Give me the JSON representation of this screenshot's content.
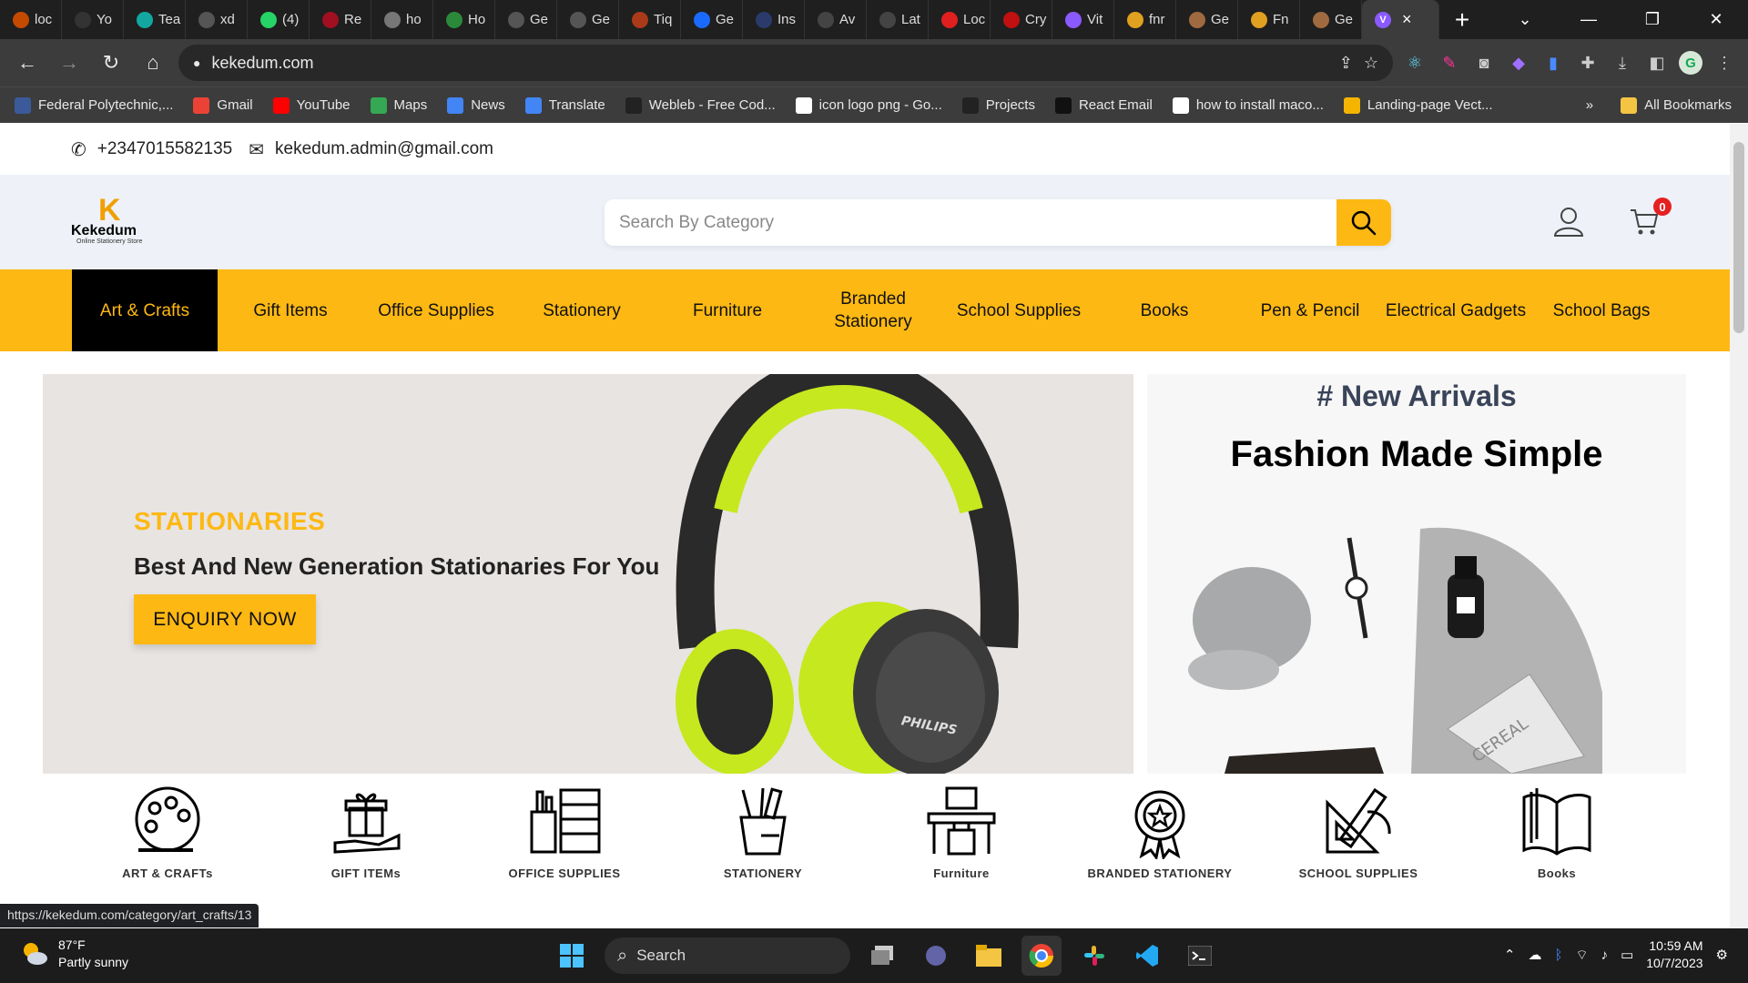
{
  "browser": {
    "tabs": [
      {
        "label": "loc",
        "color": "#c44a00"
      },
      {
        "label": "Yo",
        "color": "#333"
      },
      {
        "label": "Tea",
        "color": "#12a8a0"
      },
      {
        "label": "xd",
        "color": "#555"
      },
      {
        "label": "(4)",
        "color": "#25d366"
      },
      {
        "label": "Re",
        "color": "#a01020"
      },
      {
        "label": "ho",
        "color": "#777"
      },
      {
        "label": "Ho",
        "color": "#2a8a3a"
      },
      {
        "label": "Ge",
        "color": "#555"
      },
      {
        "label": "Ge",
        "color": "#555"
      },
      {
        "label": "Tiq",
        "color": "#aa3a1a"
      },
      {
        "label": "Ge",
        "color": "#1a6aff"
      },
      {
        "label": "Ins",
        "color": "#2a3a6a"
      },
      {
        "label": "Av",
        "color": "#444"
      },
      {
        "label": "Lat",
        "color": "#444"
      },
      {
        "label": "Loc",
        "color": "#e02020"
      },
      {
        "label": "Cry",
        "color": "#c01010"
      },
      {
        "label": "Vit",
        "color": "#8a5aff"
      },
      {
        "label": "fnr",
        "color": "#e0a020"
      },
      {
        "label": "Ge",
        "color": "#a06a40"
      },
      {
        "label": "Fn",
        "color": "#e0a020"
      },
      {
        "label": "Ge",
        "color": "#a06a40"
      }
    ],
    "active_tab_close": "×",
    "new_tab": "+",
    "url": "kekedum.com",
    "bookmarks": [
      {
        "label": "Federal Polytechnic,...",
        "color": "#3a5a9a"
      },
      {
        "label": "Gmail",
        "color": "#ea4335"
      },
      {
        "label": "YouTube",
        "color": "#ff0000"
      },
      {
        "label": "Maps",
        "color": "#34a853"
      },
      {
        "label": "News",
        "color": "#4285f4"
      },
      {
        "label": "Translate",
        "color": "#4285f4"
      },
      {
        "label": "Webleb - Free Cod...",
        "color": "#222"
      },
      {
        "label": "icon logo png - Go...",
        "color": "#fff"
      },
      {
        "label": "Projects",
        "color": "#222"
      },
      {
        "label": "React Email",
        "color": "#111"
      },
      {
        "label": "how to install maco...",
        "color": "#fff"
      },
      {
        "label": "Landing-page Vect...",
        "color": "#f4b400"
      }
    ],
    "bookmarks_overflow": "»",
    "all_bookmarks": "All Bookmarks",
    "profile_letter": "G",
    "status_url": "https://kekedum.com/category/art_crafts/13"
  },
  "site": {
    "phone": "+2347015582135",
    "email": "kekedum.admin@gmail.com",
    "logo": {
      "name": "Kekedum",
      "tagline": "Online Stationery Store"
    },
    "search_placeholder": "Search By Category",
    "cart_count": "0",
    "nav": [
      "Art & Crafts",
      "Gift Items",
      "Office Supplies",
      "Stationery",
      "Furniture",
      "Branded Stationery",
      "School Supplies",
      "Books",
      "Pen & Pencil",
      "Electrical Gadgets",
      "School Bags"
    ],
    "hero": {
      "kicker": "STATIONARIES",
      "headline": "Best And New Generation Stationaries For You",
      "cta": "ENQUIRY NOW",
      "product_brand": "PHILIPS"
    },
    "side_banner": {
      "tagline": "# New Arrivals",
      "title": "Fashion Made Simple",
      "product_text": "CEREAL"
    },
    "categories": [
      {
        "label": "ART & CRAFTs",
        "icon": "palette-icon"
      },
      {
        "label": "GIFT ITEMs",
        "icon": "gift-hand-icon"
      },
      {
        "label": "OFFICE SUPPLIES",
        "icon": "office-cabinet-icon"
      },
      {
        "label": "STATIONERY",
        "icon": "pencil-cup-icon"
      },
      {
        "label": "Furniture",
        "icon": "desk-chair-icon"
      },
      {
        "label": "BRANDED STATIONERY",
        "icon": "award-badge-icon"
      },
      {
        "label": "SCHOOL SUPPLIES",
        "icon": "ruler-set-icon"
      },
      {
        "label": "Books",
        "icon": "open-book-icon"
      }
    ]
  },
  "taskbar": {
    "weather_temp": "87°F",
    "weather_desc": "Partly sunny",
    "search_label": "Search",
    "time": "10:59 AM",
    "date": "10/7/2023"
  }
}
